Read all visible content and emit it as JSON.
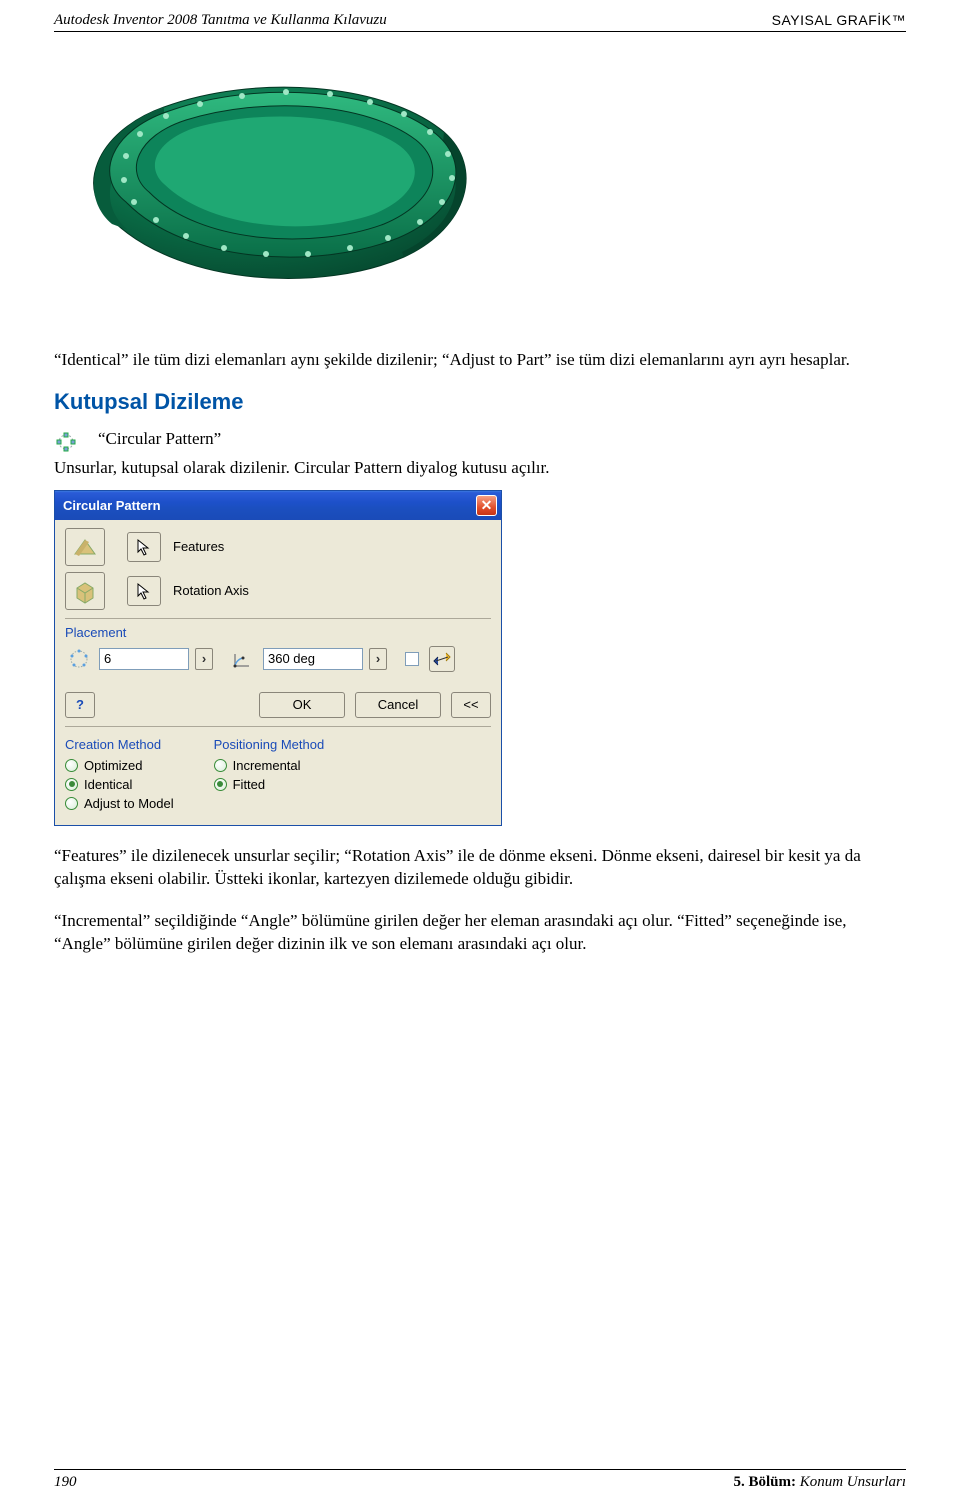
{
  "header": {
    "left": "Autodesk Inventor 2008 Tanıtma ve Kullanma Kılavuzu",
    "right": "SAYISAL GRAFİK™"
  },
  "paragraphs": {
    "identical": "“Identical” ile tüm dizi elemanları aynı şekilde dizilenir; “Adjust to Part” ise tüm dizi elemanlarını ayrı ayrı hesaplar.",
    "section_heading": "Kutupsal Dizileme",
    "tool_name": "“Circular Pattern”",
    "tool_desc": "Unsurlar, kutupsal olarak dizilenir. Circular Pattern diyalog kutusu açılır.",
    "features": "“Features” ile dizilenecek unsurlar seçilir; “Rotation Axis” ile de dönme ekseni. Dönme ekseni, dairesel bir kesit ya da çalışma ekseni olabilir. Üstteki ikonlar, kartezyen dizilemede olduğu gibidir.",
    "incremental": "“Incremental” seçildiğinde “Angle” bölümüne girilen değer her eleman arasındaki açı olur. “Fitted” seçeneğinde ise, “Angle” bölümüne girilen değer dizinin ilk ve son elemanı arasındaki açı olur."
  },
  "dialog": {
    "title": "Circular Pattern",
    "features_label": "Features",
    "rotation_axis_label": "Rotation Axis",
    "placement_label": "Placement",
    "count_value": "6",
    "angle_value": "360 deg",
    "ok": "OK",
    "cancel": "Cancel",
    "expand": "<<",
    "help": "?",
    "creation_method_label": "Creation Method",
    "creation_options": [
      "Optimized",
      "Identical",
      "Adjust to Model"
    ],
    "creation_selected": 1,
    "positioning_method_label": "Positioning Method",
    "positioning_options": [
      "Incremental",
      "Fitted"
    ],
    "positioning_selected": 1
  },
  "footer": {
    "page": "190",
    "chapter_bold": "5. Bölüm:",
    "chapter_rest": " Konum Unsurları"
  }
}
